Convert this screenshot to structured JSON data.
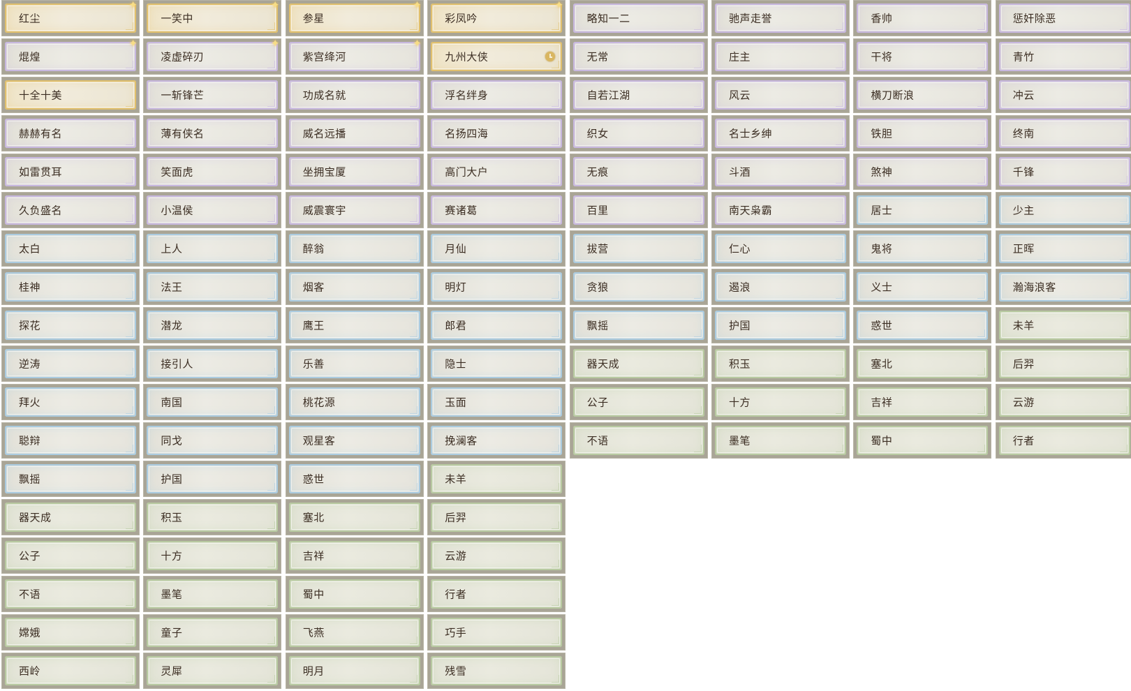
{
  "colors": {
    "gold": "#e0bf6c",
    "purple": "#c7b7df",
    "blue": "#aacbe0",
    "green": "#b7c9a0",
    "label": "#3b2d22"
  },
  "rows": [
    [
      {
        "label": "红尘",
        "tier": "gold",
        "badge": "sparkle-icon"
      },
      {
        "label": "一笑中",
        "tier": "gold",
        "badge": "sparkle-icon"
      },
      {
        "label": "参星",
        "tier": "gold",
        "badge": "sparkle-icon"
      },
      {
        "label": "彩凤吟",
        "tier": "gold",
        "badge": "sparkle-icon"
      },
      {
        "label": "略知一二",
        "tier": "purple"
      },
      {
        "label": "驰声走誉",
        "tier": "purple"
      },
      {
        "label": "香帅",
        "tier": "purple"
      },
      {
        "label": "惩奸除恶",
        "tier": "purple"
      }
    ],
    [
      {
        "label": "焜煌",
        "tier": "purple",
        "badge": "sparkle-icon"
      },
      {
        "label": "凌虚碎刃",
        "tier": "purple",
        "badge": "sparkle-icon"
      },
      {
        "label": "紫宫绛河",
        "tier": "purple",
        "badge": "sparkle-icon"
      },
      {
        "label": "九州大侠",
        "tier": "gold",
        "badge": "clock-icon"
      },
      {
        "label": "无常",
        "tier": "purple"
      },
      {
        "label": "庄主",
        "tier": "purple"
      },
      {
        "label": "干将",
        "tier": "purple"
      },
      {
        "label": "青竹",
        "tier": "purple"
      }
    ],
    [
      {
        "label": "十全十美",
        "tier": "gold"
      },
      {
        "label": "一斩锋芒",
        "tier": "purple"
      },
      {
        "label": "功成名就",
        "tier": "purple"
      },
      {
        "label": "浮名绊身",
        "tier": "purple"
      },
      {
        "label": "自若江湖",
        "tier": "purple"
      },
      {
        "label": "风云",
        "tier": "purple"
      },
      {
        "label": "横刀断浪",
        "tier": "purple"
      },
      {
        "label": "冲云",
        "tier": "purple"
      }
    ],
    [
      {
        "label": "赫赫有名",
        "tier": "purple"
      },
      {
        "label": "薄有侠名",
        "tier": "purple"
      },
      {
        "label": "威名远播",
        "tier": "purple"
      },
      {
        "label": "名扬四海",
        "tier": "purple"
      },
      {
        "label": "织女",
        "tier": "purple"
      },
      {
        "label": "名士乡绅",
        "tier": "purple"
      },
      {
        "label": "铁胆",
        "tier": "purple"
      },
      {
        "label": "终南",
        "tier": "purple"
      }
    ],
    [
      {
        "label": "如雷贯耳",
        "tier": "purple"
      },
      {
        "label": "笑面虎",
        "tier": "purple"
      },
      {
        "label": "坐拥宝厦",
        "tier": "purple"
      },
      {
        "label": "高门大户",
        "tier": "purple"
      },
      {
        "label": "无痕",
        "tier": "purple"
      },
      {
        "label": "斗酒",
        "tier": "purple"
      },
      {
        "label": "煞神",
        "tier": "purple"
      },
      {
        "label": "千锋",
        "tier": "purple"
      }
    ],
    [
      {
        "label": "久负盛名",
        "tier": "purple"
      },
      {
        "label": "小温侯",
        "tier": "purple"
      },
      {
        "label": "威震寰宇",
        "tier": "purple"
      },
      {
        "label": "赛诸葛",
        "tier": "purple"
      },
      {
        "label": "百里",
        "tier": "purple"
      },
      {
        "label": "南天枭霸",
        "tier": "purple"
      },
      {
        "label": "居士",
        "tier": "blue"
      },
      {
        "label": "少主",
        "tier": "blue"
      }
    ],
    [
      {
        "label": "太白",
        "tier": "blue"
      },
      {
        "label": "上人",
        "tier": "blue"
      },
      {
        "label": "醉翁",
        "tier": "blue"
      },
      {
        "label": "月仙",
        "tier": "blue"
      },
      {
        "label": "拔营",
        "tier": "blue"
      },
      {
        "label": "仁心",
        "tier": "blue"
      },
      {
        "label": "鬼将",
        "tier": "blue"
      },
      {
        "label": "正晖",
        "tier": "blue"
      }
    ],
    [
      {
        "label": "桂神",
        "tier": "blue"
      },
      {
        "label": "法王",
        "tier": "blue"
      },
      {
        "label": "烟客",
        "tier": "blue"
      },
      {
        "label": "明灯",
        "tier": "blue"
      },
      {
        "label": "贪狼",
        "tier": "blue"
      },
      {
        "label": "遏浪",
        "tier": "blue"
      },
      {
        "label": "义士",
        "tier": "blue"
      },
      {
        "label": "瀚海浪客",
        "tier": "blue"
      }
    ],
    [
      {
        "label": "探花",
        "tier": "blue"
      },
      {
        "label": "潜龙",
        "tier": "blue"
      },
      {
        "label": "鹰王",
        "tier": "blue"
      },
      {
        "label": "郎君",
        "tier": "blue"
      },
      {
        "label": "飘摇",
        "tier": "blue"
      },
      {
        "label": "护国",
        "tier": "blue"
      },
      {
        "label": "惑世",
        "tier": "blue"
      },
      {
        "label": "未羊",
        "tier": "green"
      }
    ],
    [
      {
        "label": "逆涛",
        "tier": "blue"
      },
      {
        "label": "接引人",
        "tier": "blue"
      },
      {
        "label": "乐善",
        "tier": "blue"
      },
      {
        "label": "隐士",
        "tier": "blue"
      },
      {
        "label": "器天成",
        "tier": "green"
      },
      {
        "label": "积玉",
        "tier": "green"
      },
      {
        "label": "塞北",
        "tier": "green"
      },
      {
        "label": "后羿",
        "tier": "green"
      }
    ],
    [
      {
        "label": "拜火",
        "tier": "blue"
      },
      {
        "label": "南国",
        "tier": "blue"
      },
      {
        "label": "桃花源",
        "tier": "blue"
      },
      {
        "label": "玉面",
        "tier": "blue"
      },
      {
        "label": "公子",
        "tier": "green"
      },
      {
        "label": "十方",
        "tier": "green"
      },
      {
        "label": "吉祥",
        "tier": "green"
      },
      {
        "label": "云游",
        "tier": "green"
      }
    ],
    [
      {
        "label": "聪辩",
        "tier": "blue"
      },
      {
        "label": "同戈",
        "tier": "blue"
      },
      {
        "label": "观星客",
        "tier": "blue"
      },
      {
        "label": "挽澜客",
        "tier": "blue"
      },
      {
        "label": "不语",
        "tier": "green"
      },
      {
        "label": "墨笔",
        "tier": "green"
      },
      {
        "label": "蜀中",
        "tier": "green"
      },
      {
        "label": "行者",
        "tier": "green"
      }
    ],
    [
      {
        "label": "飘摇",
        "tier": "blue"
      },
      {
        "label": "护国",
        "tier": "blue"
      },
      {
        "label": "惑世",
        "tier": "blue"
      },
      {
        "label": "未羊",
        "tier": "green"
      }
    ],
    [
      {
        "label": "器天成",
        "tier": "green"
      },
      {
        "label": "积玉",
        "tier": "green"
      },
      {
        "label": "塞北",
        "tier": "green"
      },
      {
        "label": "后羿",
        "tier": "green"
      }
    ],
    [
      {
        "label": "公子",
        "tier": "green"
      },
      {
        "label": "十方",
        "tier": "green"
      },
      {
        "label": "吉祥",
        "tier": "green"
      },
      {
        "label": "云游",
        "tier": "green"
      }
    ],
    [
      {
        "label": "不语",
        "tier": "green"
      },
      {
        "label": "墨笔",
        "tier": "green"
      },
      {
        "label": "蜀中",
        "tier": "green"
      },
      {
        "label": "行者",
        "tier": "green"
      }
    ],
    [
      {
        "label": "嫦娥",
        "tier": "green"
      },
      {
        "label": "童子",
        "tier": "green"
      },
      {
        "label": "飞燕",
        "tier": "green"
      },
      {
        "label": "巧手",
        "tier": "green"
      }
    ],
    [
      {
        "label": "西岭",
        "tier": "green"
      },
      {
        "label": "灵犀",
        "tier": "green"
      },
      {
        "label": "明月",
        "tier": "green"
      },
      {
        "label": "残雪",
        "tier": "green"
      }
    ]
  ]
}
